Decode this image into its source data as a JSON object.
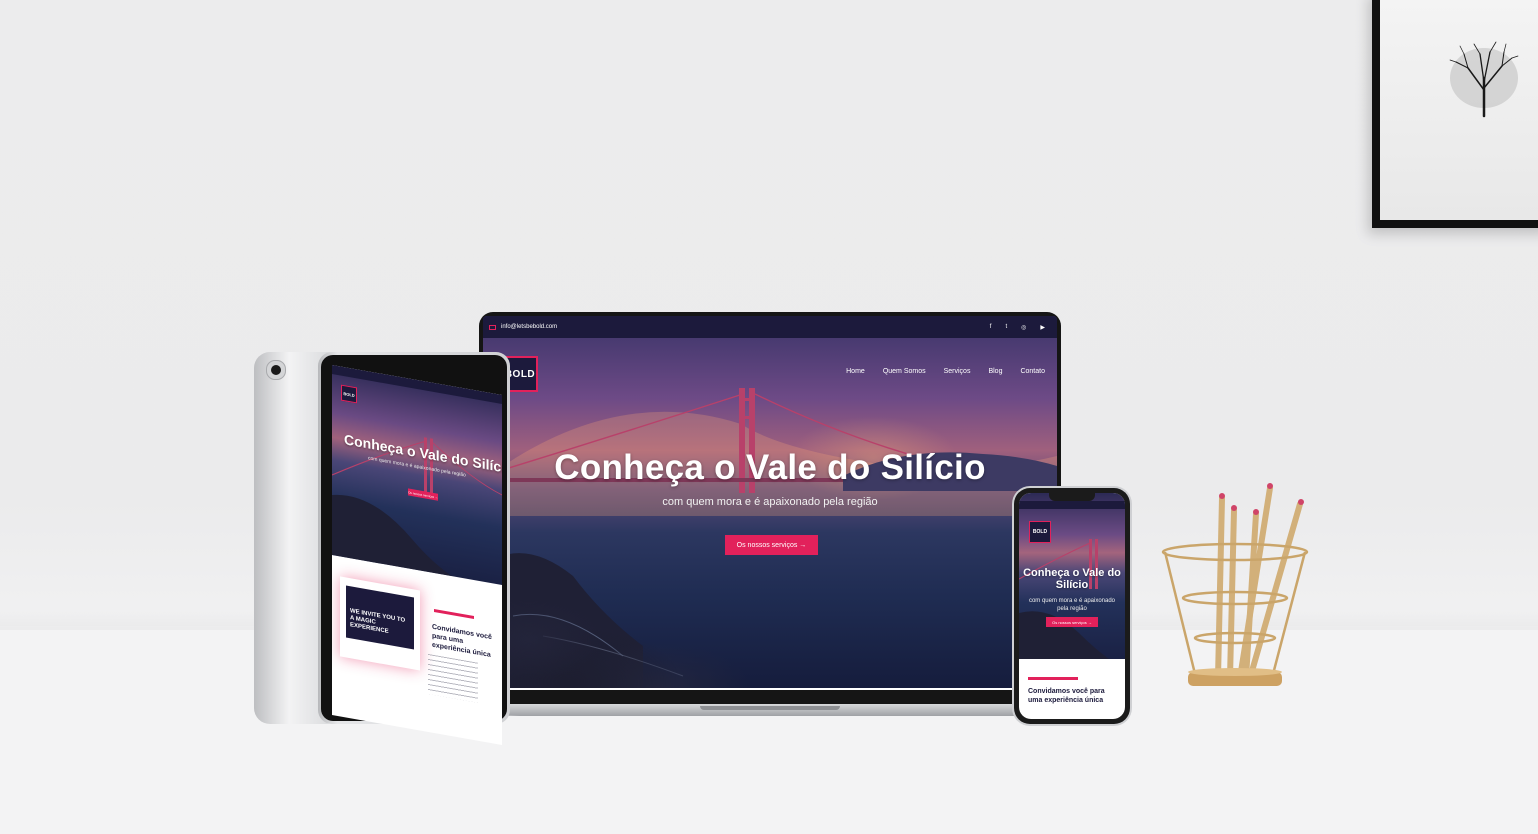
{
  "laptop_site": {
    "topbar": {
      "email": "info@letsbebold.com",
      "social_icons": [
        "facebook-icon",
        "twitter-icon",
        "instagram-icon",
        "youtube-icon"
      ],
      "social_glyphs": [
        "f",
        "t",
        "◎",
        "▶"
      ]
    },
    "logo_text": "BOLD",
    "nav": [
      "Home",
      "Quem Somos",
      "Serviços",
      "Blog",
      "Contato"
    ],
    "hero": {
      "title": "Conheça o Vale do Silício",
      "subtitle": "com quem mora e é apaixonado pela região",
      "button": "Os nossos serviços →"
    }
  },
  "tablet_site": {
    "logo_text": "BOLD",
    "hero": {
      "title": "Conheça o Vale do Silício",
      "subtitle": "com quem mora e é apaixonado pela região",
      "button": "Os nossos serviços →"
    },
    "card_text": "WE INVITE YOU TO A MAGIC EXPERIENCE",
    "section_heading": "Convidamos você para uma experiência única"
  },
  "phone_site": {
    "logo_text": "BOLD",
    "hero": {
      "title": "Conheça o Vale do Silício",
      "subtitle": "com quem mora e é apaixonado pela região",
      "button": "Os nossos serviços →"
    },
    "section_heading": "Convidamos você para uma experiência única"
  },
  "colors": {
    "accent": "#e2215b",
    "navy": "#1c1a3c"
  }
}
